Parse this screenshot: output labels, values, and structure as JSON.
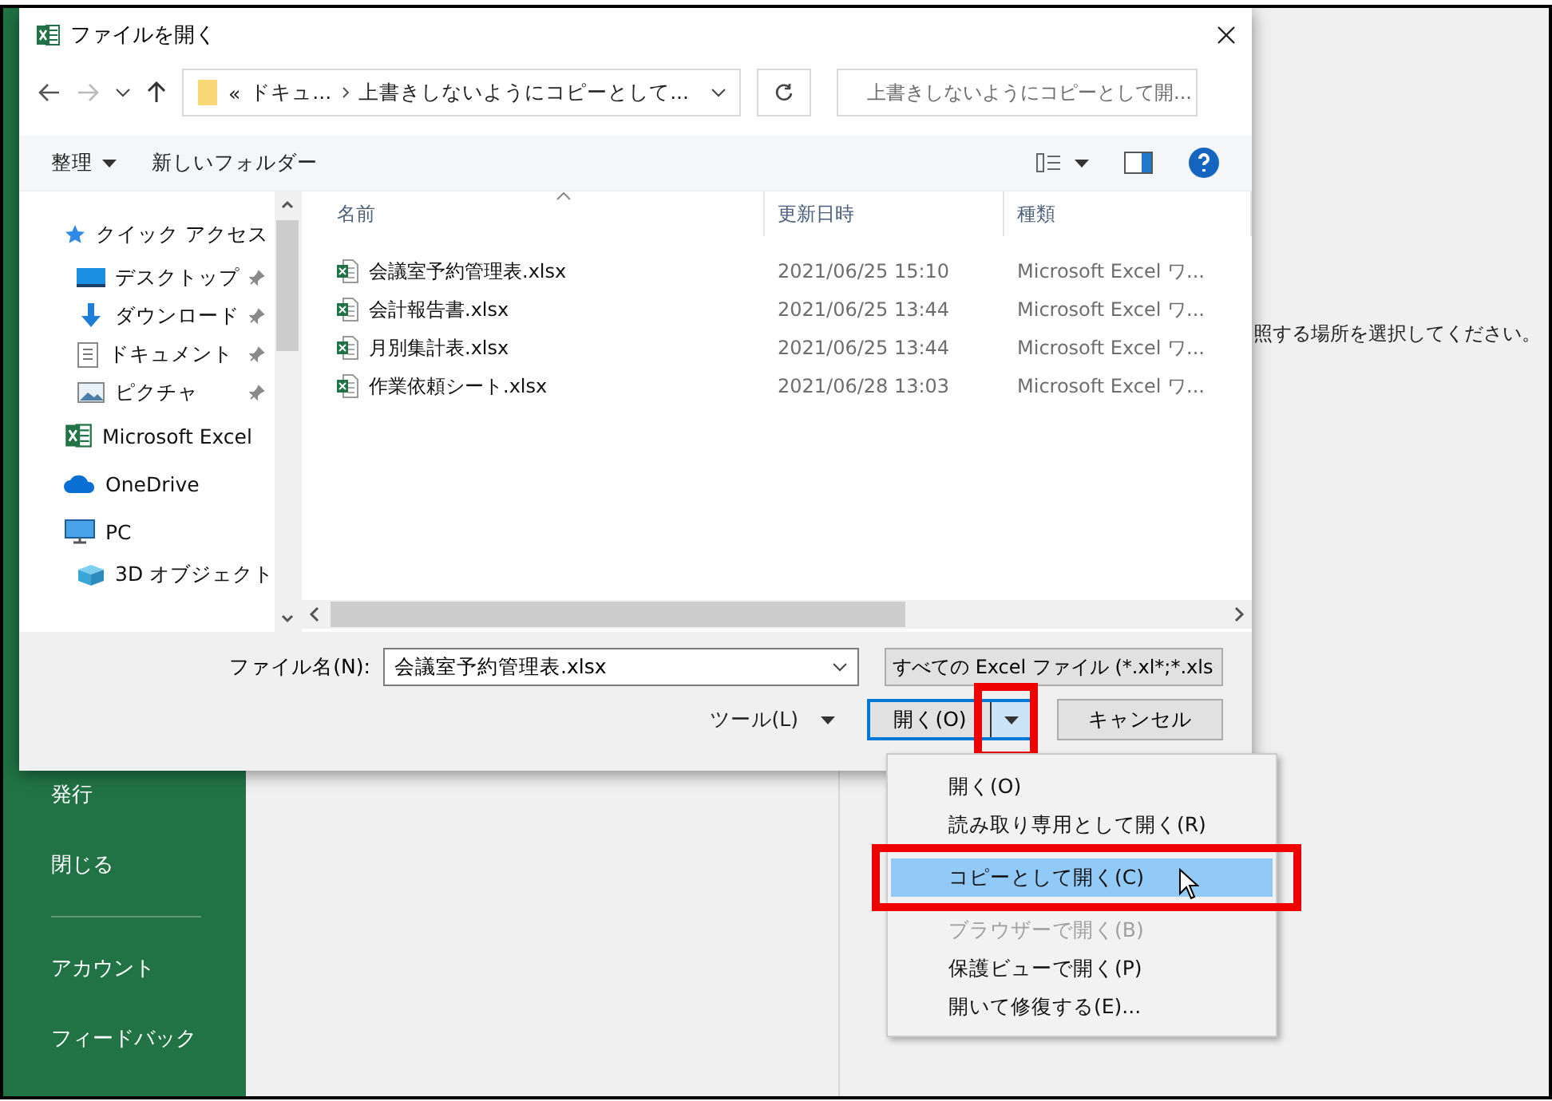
{
  "backstage": {
    "nav_items": [
      {
        "label": "発行"
      },
      {
        "label": "閉じる"
      }
    ],
    "nav_bottom": [
      {
        "label": "アカウント"
      },
      {
        "label": "フィードバック"
      }
    ],
    "hint": "照する場所を選択してください。"
  },
  "dialog": {
    "title": "ファイルを開く",
    "address": {
      "overflow": "«",
      "segments": [
        "ドキュ...",
        "上書きしないようにコピーとして..."
      ]
    },
    "search": {
      "placeholder": "上書きしないようにコピーとして開..."
    },
    "toolbar": {
      "organize": "整理",
      "new_folder": "新しいフォルダー"
    },
    "nav": [
      {
        "label": "クイック アクセス",
        "kind": "star",
        "children": [
          {
            "label": "デスクトップ",
            "kind": "desktop",
            "pinned": true
          },
          {
            "label": "ダウンロード",
            "kind": "download",
            "pinned": true
          },
          {
            "label": "ドキュメント",
            "kind": "document",
            "pinned": true
          },
          {
            "label": "ピクチャ",
            "kind": "picture",
            "pinned": true
          }
        ]
      },
      {
        "label": "Microsoft Excel",
        "kind": "excel"
      },
      {
        "label": "OneDrive",
        "kind": "cloud"
      },
      {
        "label": "PC",
        "kind": "pc",
        "children": [
          {
            "label": "3D オブジェクト",
            "kind": "cube",
            "pinned": false
          }
        ]
      }
    ],
    "columns": [
      {
        "label": "名前",
        "sorted": true
      },
      {
        "label": "更新日時",
        "sorted": false
      },
      {
        "label": "種類",
        "sorted": false
      }
    ],
    "files": [
      {
        "name": "会議室予約管理表.xlsx",
        "modified": "2021/06/25 15:10",
        "type": "Microsoft Excel ワ..."
      },
      {
        "name": "会計報告書.xlsx",
        "modified": "2021/06/25 13:44",
        "type": "Microsoft Excel ワ..."
      },
      {
        "name": "月別集計表.xlsx",
        "modified": "2021/06/25 13:44",
        "type": "Microsoft Excel ワ..."
      },
      {
        "name": "作業依頼シート.xlsx",
        "modified": "2021/06/28 13:03",
        "type": "Microsoft Excel ワ..."
      }
    ],
    "filename": {
      "label": "ファイル名(N):",
      "value": "会議室予約管理表.xlsx"
    },
    "filetype": {
      "value": "すべての Excel ファイル (*.xl*;*.xls"
    },
    "tools": "ツール(L)",
    "open": {
      "label": "開く(O)",
      "arrow_annotated": true
    },
    "cancel": "キャンセル"
  },
  "open_menu": [
    {
      "label": "開く(O)",
      "selected": false,
      "disabled": false,
      "annotated": false
    },
    {
      "label": "読み取り専用として開く(R)",
      "selected": false,
      "disabled": false,
      "annotated": false
    },
    {
      "label": "コピーとして開く(C)",
      "selected": true,
      "disabled": false,
      "annotated": true
    },
    {
      "label": "ブラウザーで開く(B)",
      "selected": false,
      "disabled": true,
      "annotated": false
    },
    {
      "label": "保護ビューで開く(P)",
      "selected": false,
      "disabled": false,
      "annotated": false
    },
    {
      "label": "開いて修復する(E)...",
      "selected": false,
      "disabled": false,
      "annotated": false
    }
  ]
}
